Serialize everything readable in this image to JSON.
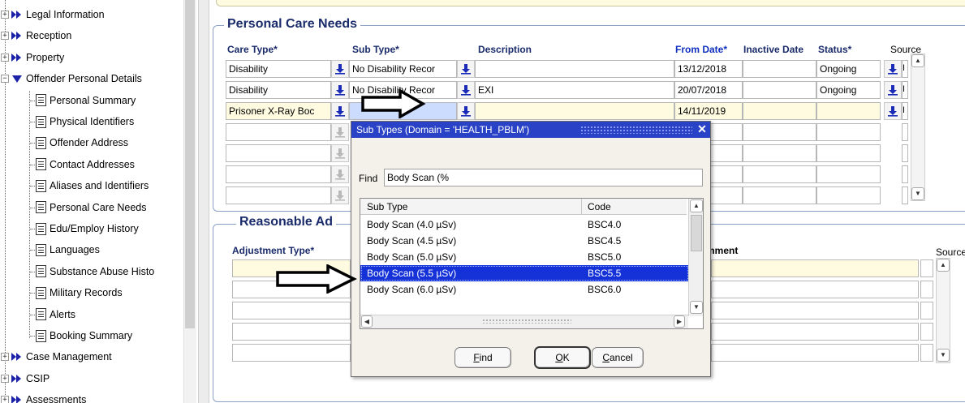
{
  "tree": {
    "items": [
      {
        "label": "Legal Information",
        "kind": "folder",
        "expanded": false
      },
      {
        "label": "Reception",
        "kind": "folder",
        "expanded": false
      },
      {
        "label": "Property",
        "kind": "folder",
        "expanded": false
      },
      {
        "label": "Offender Personal Details",
        "kind": "folder",
        "expanded": true
      },
      {
        "label": "Personal Summary",
        "kind": "leaf"
      },
      {
        "label": "Physical Identifiers",
        "kind": "leaf"
      },
      {
        "label": "Offender Address",
        "kind": "leaf"
      },
      {
        "label": "Contact Addresses",
        "kind": "leaf"
      },
      {
        "label": "Aliases and Identifiers",
        "kind": "leaf"
      },
      {
        "label": "Personal Care Needs",
        "kind": "leaf"
      },
      {
        "label": "Edu/Employ History",
        "kind": "leaf"
      },
      {
        "label": "Languages",
        "kind": "leaf"
      },
      {
        "label": "Substance Abuse Histo",
        "kind": "leaf"
      },
      {
        "label": "Military Records",
        "kind": "leaf"
      },
      {
        "label": "Alerts",
        "kind": "leaf"
      },
      {
        "label": "Booking Summary",
        "kind": "leaf"
      },
      {
        "label": "Case Management",
        "kind": "folder",
        "expanded": false
      },
      {
        "label": "CSIP",
        "kind": "folder",
        "expanded": false
      },
      {
        "label": "Assessments",
        "kind": "folder",
        "expanded": false
      }
    ]
  },
  "care": {
    "title": "Personal Care Needs",
    "headers": {
      "care_type": "Care Type*",
      "sub_type": "Sub Type*",
      "description": "Description",
      "from_date": "From Date*",
      "inactive_date": "Inactive Date",
      "status": "Status*",
      "source": "Source"
    },
    "rows": [
      {
        "care_type": "Disability",
        "sub_type": "No Disability Recor",
        "description": "",
        "from_date": "13/12/2018",
        "inactive_date": "",
        "status": "Ongoing",
        "source": "I"
      },
      {
        "care_type": "Disability",
        "sub_type": "No Disability Recor",
        "description": "EXI",
        "from_date": "20/07/2018",
        "inactive_date": "",
        "status": "Ongoing",
        "source": "I"
      },
      {
        "care_type": "Prisoner X-Ray Boc",
        "sub_type": "",
        "description": "",
        "from_date": "14/11/2019",
        "inactive_date": "",
        "status": "",
        "source": "I"
      },
      {
        "care_type": "",
        "sub_type": "",
        "description": "",
        "from_date": "",
        "inactive_date": "",
        "status": "",
        "source": ""
      },
      {
        "care_type": "",
        "sub_type": "",
        "description": "",
        "from_date": "",
        "inactive_date": "",
        "status": "",
        "source": ""
      },
      {
        "care_type": "",
        "sub_type": "",
        "description": "",
        "from_date": "",
        "inactive_date": "",
        "status": "",
        "source": ""
      },
      {
        "care_type": "",
        "sub_type": "",
        "description": "",
        "from_date": "",
        "inactive_date": "",
        "status": "",
        "source": ""
      }
    ]
  },
  "adjust": {
    "title": "Reasonable Ad",
    "headers": {
      "adjustment_type": "Adjustment Type*",
      "comment": "mment",
      "source": "Source"
    }
  },
  "dialog": {
    "title": "Sub Types (Domain = 'HEALTH_PBLM')",
    "find_label": "Find",
    "find_value": "Body Scan (%",
    "list_headers": {
      "sub_type": "Sub Type",
      "code": "Code"
    },
    "rows": [
      {
        "sub_type": "Body Scan (4.0 µSv)",
        "code": "BSC4.0",
        "selected": false
      },
      {
        "sub_type": "Body Scan (4.5 µSv)",
        "code": "BSC4.5",
        "selected": false
      },
      {
        "sub_type": "Body Scan (5.0 µSv)",
        "code": "BSC5.0",
        "selected": false
      },
      {
        "sub_type": "Body Scan (5.5 µSv)",
        "code": "BSC5.5",
        "selected": true
      },
      {
        "sub_type": "Body Scan (6.0 µSv)",
        "code": "BSC6.0",
        "selected": false
      }
    ],
    "buttons": {
      "find": "Find",
      "ok": "OK",
      "cancel": "Cancel"
    },
    "button_mnemonics": {
      "find": "F",
      "ok": "O",
      "cancel": "C"
    }
  },
  "colors": {
    "header_blue": "#1030c0",
    "title_navy": "#1a2b6b",
    "required_bg": "#fffbe0",
    "selection": "#1432d8",
    "dialog_title": "#2a43c6",
    "lov_arrow": "#1a2bb8"
  },
  "icons": {
    "lov": "download-arrow-icon",
    "nav": "nav-arrow-icon",
    "doc": "document-icon",
    "annotation": "outline-arrow-icon"
  }
}
